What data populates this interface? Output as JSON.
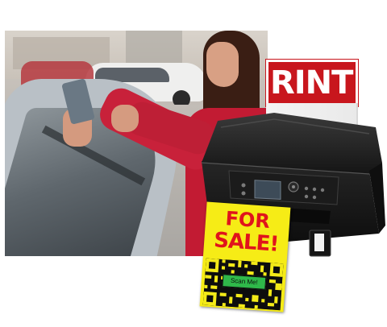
{
  "banner": {
    "text": "RINT"
  },
  "sign": {
    "line1": "FOR",
    "line2": "SALE!",
    "qr_caption": "Scan Me!"
  },
  "printer": {
    "icon": "inkjet-printer-icon"
  },
  "photo": {
    "subject": "woman-photographing-car-photo"
  },
  "colors": {
    "banner_red": "#c8161d",
    "sign_yellow": "#f6ec16",
    "sign_text_red": "#e0141c",
    "qr_green": "#2fb84a",
    "printer_body": "#1f1f1f"
  }
}
